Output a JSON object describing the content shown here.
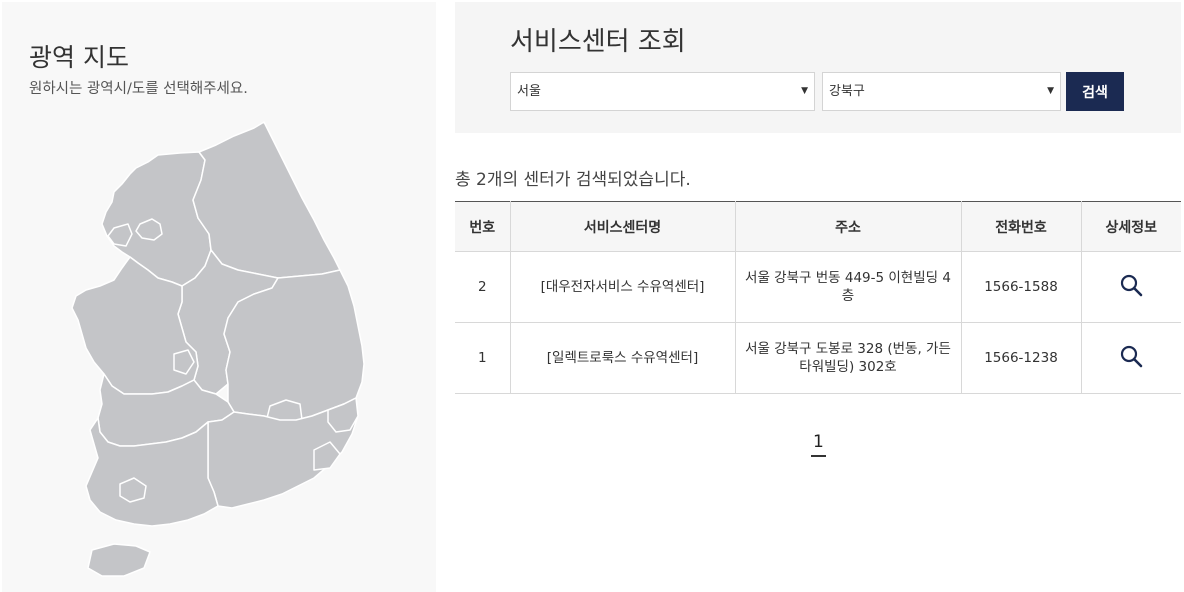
{
  "map": {
    "title": "광역 지도",
    "subtitle": "원하시는 광역시/도를 선택해주세요.",
    "fill_color": "#c4c5c8",
    "border_color": "#ffffff"
  },
  "search": {
    "title": "서비스센터 조회",
    "region_select": "서울",
    "district_select": "강북구",
    "button_label": "검색",
    "button_color": "#1b2a52"
  },
  "results": {
    "count_text": "총 2개의 센터가 검색되었습니다.",
    "headers": [
      "번호",
      "서비스센터명",
      "주소",
      "전화번호",
      "상세정보"
    ],
    "rows": [
      {
        "no": "2",
        "name": "[대우전자서비스 수유역센터]",
        "address": "서울 강북구 번동 449-5 이현빌딩 4층",
        "phone": "1566-1588",
        "detail_icon": "search-icon"
      },
      {
        "no": "1",
        "name": "[일렉트로룩스 수유역센터]",
        "address": "서울 강북구 도봉로 328 (번동, 가든타워빌딩) 302호",
        "phone": "1566-1238",
        "detail_icon": "search-icon"
      }
    ]
  },
  "pagination": {
    "current_page": "1"
  }
}
